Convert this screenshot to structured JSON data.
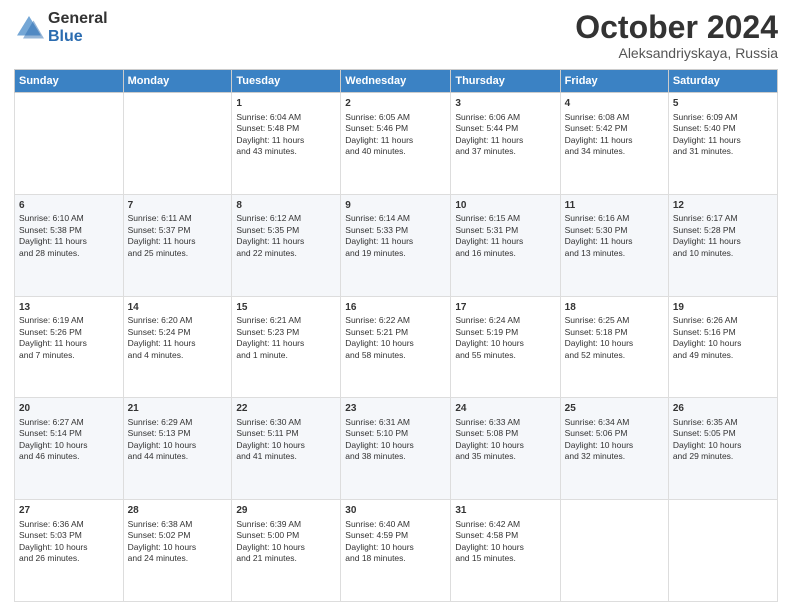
{
  "header": {
    "logo_general": "General",
    "logo_blue": "Blue",
    "title": "October 2024",
    "location": "Aleksandriyskaya, Russia"
  },
  "days_of_week": [
    "Sunday",
    "Monday",
    "Tuesday",
    "Wednesday",
    "Thursday",
    "Friday",
    "Saturday"
  ],
  "weeks": [
    [
      {
        "num": "",
        "info": ""
      },
      {
        "num": "",
        "info": ""
      },
      {
        "num": "1",
        "info": "Sunrise: 6:04 AM\nSunset: 5:48 PM\nDaylight: 11 hours\nand 43 minutes."
      },
      {
        "num": "2",
        "info": "Sunrise: 6:05 AM\nSunset: 5:46 PM\nDaylight: 11 hours\nand 40 minutes."
      },
      {
        "num": "3",
        "info": "Sunrise: 6:06 AM\nSunset: 5:44 PM\nDaylight: 11 hours\nand 37 minutes."
      },
      {
        "num": "4",
        "info": "Sunrise: 6:08 AM\nSunset: 5:42 PM\nDaylight: 11 hours\nand 34 minutes."
      },
      {
        "num": "5",
        "info": "Sunrise: 6:09 AM\nSunset: 5:40 PM\nDaylight: 11 hours\nand 31 minutes."
      }
    ],
    [
      {
        "num": "6",
        "info": "Sunrise: 6:10 AM\nSunset: 5:38 PM\nDaylight: 11 hours\nand 28 minutes."
      },
      {
        "num": "7",
        "info": "Sunrise: 6:11 AM\nSunset: 5:37 PM\nDaylight: 11 hours\nand 25 minutes."
      },
      {
        "num": "8",
        "info": "Sunrise: 6:12 AM\nSunset: 5:35 PM\nDaylight: 11 hours\nand 22 minutes."
      },
      {
        "num": "9",
        "info": "Sunrise: 6:14 AM\nSunset: 5:33 PM\nDaylight: 11 hours\nand 19 minutes."
      },
      {
        "num": "10",
        "info": "Sunrise: 6:15 AM\nSunset: 5:31 PM\nDaylight: 11 hours\nand 16 minutes."
      },
      {
        "num": "11",
        "info": "Sunrise: 6:16 AM\nSunset: 5:30 PM\nDaylight: 11 hours\nand 13 minutes."
      },
      {
        "num": "12",
        "info": "Sunrise: 6:17 AM\nSunset: 5:28 PM\nDaylight: 11 hours\nand 10 minutes."
      }
    ],
    [
      {
        "num": "13",
        "info": "Sunrise: 6:19 AM\nSunset: 5:26 PM\nDaylight: 11 hours\nand 7 minutes."
      },
      {
        "num": "14",
        "info": "Sunrise: 6:20 AM\nSunset: 5:24 PM\nDaylight: 11 hours\nand 4 minutes."
      },
      {
        "num": "15",
        "info": "Sunrise: 6:21 AM\nSunset: 5:23 PM\nDaylight: 11 hours\nand 1 minute."
      },
      {
        "num": "16",
        "info": "Sunrise: 6:22 AM\nSunset: 5:21 PM\nDaylight: 10 hours\nand 58 minutes."
      },
      {
        "num": "17",
        "info": "Sunrise: 6:24 AM\nSunset: 5:19 PM\nDaylight: 10 hours\nand 55 minutes."
      },
      {
        "num": "18",
        "info": "Sunrise: 6:25 AM\nSunset: 5:18 PM\nDaylight: 10 hours\nand 52 minutes."
      },
      {
        "num": "19",
        "info": "Sunrise: 6:26 AM\nSunset: 5:16 PM\nDaylight: 10 hours\nand 49 minutes."
      }
    ],
    [
      {
        "num": "20",
        "info": "Sunrise: 6:27 AM\nSunset: 5:14 PM\nDaylight: 10 hours\nand 46 minutes."
      },
      {
        "num": "21",
        "info": "Sunrise: 6:29 AM\nSunset: 5:13 PM\nDaylight: 10 hours\nand 44 minutes."
      },
      {
        "num": "22",
        "info": "Sunrise: 6:30 AM\nSunset: 5:11 PM\nDaylight: 10 hours\nand 41 minutes."
      },
      {
        "num": "23",
        "info": "Sunrise: 6:31 AM\nSunset: 5:10 PM\nDaylight: 10 hours\nand 38 minutes."
      },
      {
        "num": "24",
        "info": "Sunrise: 6:33 AM\nSunset: 5:08 PM\nDaylight: 10 hours\nand 35 minutes."
      },
      {
        "num": "25",
        "info": "Sunrise: 6:34 AM\nSunset: 5:06 PM\nDaylight: 10 hours\nand 32 minutes."
      },
      {
        "num": "26",
        "info": "Sunrise: 6:35 AM\nSunset: 5:05 PM\nDaylight: 10 hours\nand 29 minutes."
      }
    ],
    [
      {
        "num": "27",
        "info": "Sunrise: 6:36 AM\nSunset: 5:03 PM\nDaylight: 10 hours\nand 26 minutes."
      },
      {
        "num": "28",
        "info": "Sunrise: 6:38 AM\nSunset: 5:02 PM\nDaylight: 10 hours\nand 24 minutes."
      },
      {
        "num": "29",
        "info": "Sunrise: 6:39 AM\nSunset: 5:00 PM\nDaylight: 10 hours\nand 21 minutes."
      },
      {
        "num": "30",
        "info": "Sunrise: 6:40 AM\nSunset: 4:59 PM\nDaylight: 10 hours\nand 18 minutes."
      },
      {
        "num": "31",
        "info": "Sunrise: 6:42 AM\nSunset: 4:58 PM\nDaylight: 10 hours\nand 15 minutes."
      },
      {
        "num": "",
        "info": ""
      },
      {
        "num": "",
        "info": ""
      }
    ]
  ]
}
